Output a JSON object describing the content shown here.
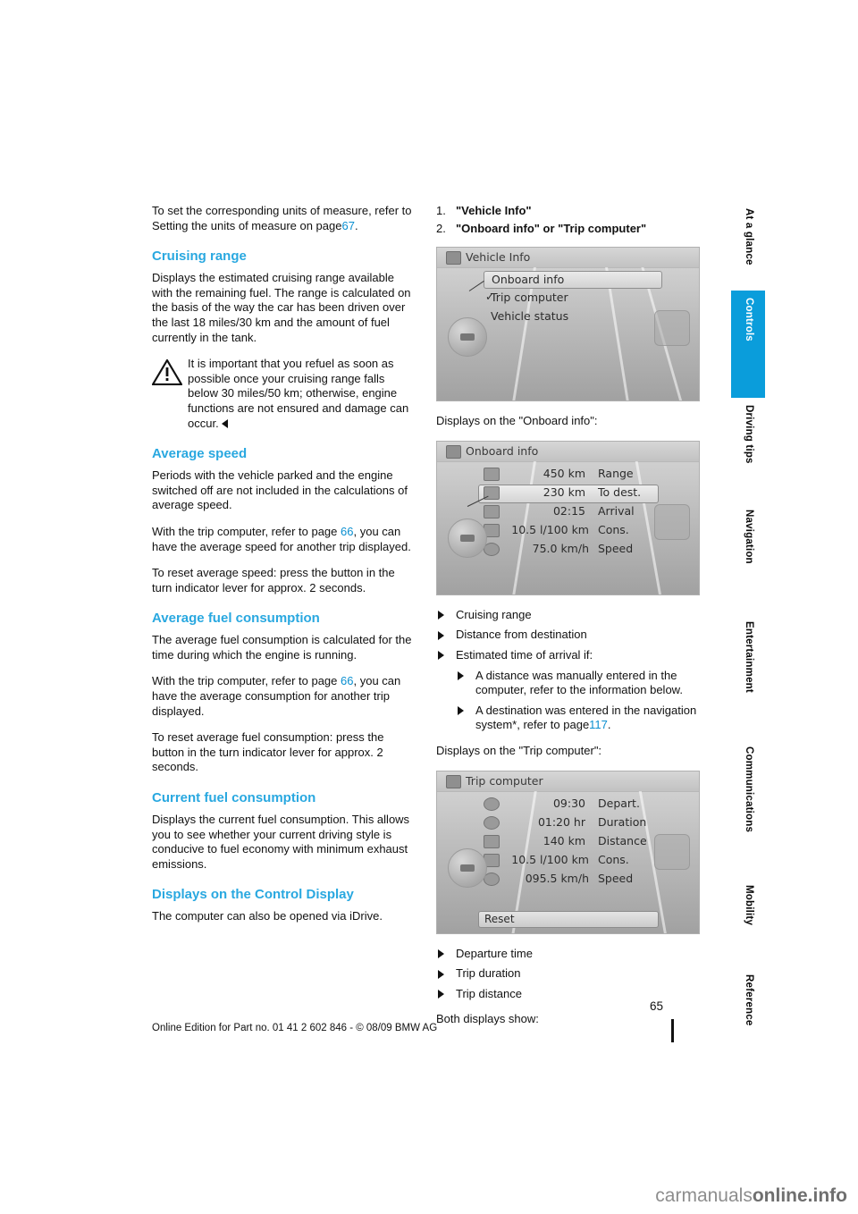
{
  "left_column": {
    "intro_paragraph": "To set the corresponding units of measure, refer to Setting the units of measure on page",
    "intro_page_ref": "67",
    "intro_period": ".",
    "cruising_range": {
      "heading": "Cruising range",
      "body": "Displays the estimated cruising range available with the remaining fuel. The range is calculated on the basis of the way the car has been driven over the last 18 miles/30 km and the amount of fuel currently in the tank.",
      "warning": "It is important that you refuel as soon as possible once your cruising range falls below 30 miles/50 km; otherwise, engine functions are not ensured and damage can occur."
    },
    "average_speed": {
      "heading": "Average speed",
      "body1": "Periods with the vehicle parked and the engine switched off are not included in the calculations of average speed.",
      "body2_pre": "With the trip computer, refer to page",
      "body2_ref": "66",
      "body2_post": ", you can have the average speed for another trip displayed.",
      "body3": "To reset average speed: press the button in the turn indicator lever for approx. 2 seconds."
    },
    "average_fuel": {
      "heading": "Average fuel consumption",
      "body1": "The average fuel consumption is calculated for the time during which the engine is running.",
      "body2_pre": "With the trip computer, refer to page",
      "body2_ref": "66",
      "body2_post": ", you can have the average consumption for another trip displayed.",
      "body3": "To reset average fuel consumption: press the button in the turn indicator lever for approx. 2 seconds."
    },
    "current_fuel": {
      "heading": "Current fuel consumption",
      "body": "Displays the current fuel consumption. This allows you to see whether your current driving style is conducive to fuel economy with minimum exhaust emissions."
    },
    "control_display": {
      "heading": "Displays on the Control Display",
      "body": "The computer can also be opened via iDrive."
    }
  },
  "right_column": {
    "steps": [
      {
        "num": "1.",
        "text": "\"Vehicle Info\""
      },
      {
        "num": "2.",
        "text": "\"Onboard info\" or \"Trip computer\""
      }
    ],
    "screen_vehicle_info": {
      "title": "Vehicle Info",
      "items": [
        {
          "label": "Onboard info",
          "selected": true,
          "checked": false
        },
        {
          "label": "Trip computer",
          "selected": false,
          "checked": true
        },
        {
          "label": "Vehicle status",
          "selected": false,
          "checked": false
        }
      ]
    },
    "onboard_caption": "Displays on the \"Onboard info\":",
    "screen_onboard_info": {
      "title": "Onboard info",
      "rows": [
        {
          "value": "450  km",
          "label": "Range"
        },
        {
          "value": "230  km",
          "label": "To dest.",
          "highlight": true
        },
        {
          "value": "02:15",
          "label": "Arrival"
        },
        {
          "value": "10.5 l/100 km",
          "label": "Cons."
        },
        {
          "value": "75.0 km/h",
          "label": "Speed"
        }
      ]
    },
    "onboard_bullets": [
      {
        "text": "Cruising range",
        "level": 1
      },
      {
        "text": "Distance from destination",
        "level": 1
      },
      {
        "text": "Estimated time of arrival if:",
        "level": 1
      },
      {
        "text": "A distance was manually entered in the computer, refer to the information below.",
        "level": 2
      },
      {
        "text": "A destination was entered in the navigation system*, refer to page",
        "level": 2,
        "page_ref": "117",
        "page_post": "."
      }
    ],
    "trip_caption": "Displays on the \"Trip computer\":",
    "screen_trip_computer": {
      "title": "Trip computer",
      "rows": [
        {
          "value": "09:30",
          "label": "Depart."
        },
        {
          "value": "01:20  hr",
          "label": "Duration"
        },
        {
          "value": "140    km",
          "label": "Distance"
        },
        {
          "value": "10.5 l/100 km",
          "label": "Cons."
        },
        {
          "value": "095.5 km/h",
          "label": "Speed"
        }
      ],
      "reset_button": "Reset"
    },
    "trip_bullets": [
      "Departure time",
      "Trip duration",
      "Trip distance"
    ],
    "both_displays": "Both displays show:"
  },
  "side_tabs": [
    {
      "label": "At a glance",
      "active": false
    },
    {
      "label": "Controls",
      "active": true
    },
    {
      "label": "Driving tips",
      "active": false
    },
    {
      "label": "Navigation",
      "active": false
    },
    {
      "label": "Entertainment",
      "active": false
    },
    {
      "label": "Communications",
      "active": false
    },
    {
      "label": "Mobility",
      "active": false
    },
    {
      "label": "Reference",
      "active": false
    }
  ],
  "footer": {
    "page_number": "65",
    "edition_line": "Online Edition for Part no. 01 41 2 602 846 - © 08/09 BMW AG"
  },
  "watermark": {
    "prefix": "carmanuals",
    "suffix": "online.info"
  },
  "colors": {
    "accent": "#0a9ddb",
    "heading": "#29a8e0",
    "link": "#0a8fd0"
  }
}
